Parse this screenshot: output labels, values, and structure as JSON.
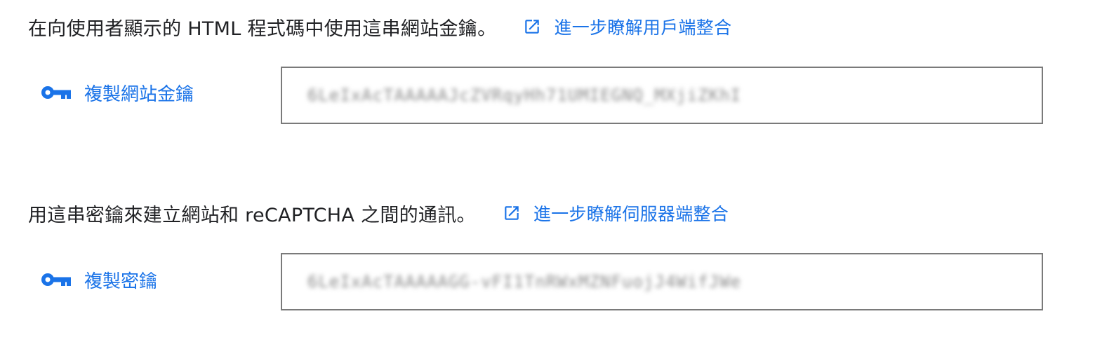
{
  "site_key_section": {
    "description": "在向使用者顯示的 HTML 程式碼中使用這串網站金鑰。",
    "learn_more_label": "進一步瞭解用戶端整合",
    "copy_label": "複製網站金鑰",
    "key_value": "6LeIxAcTAAAAAJcZVRqyHh71UMIEGNQ_MXjiZKhI"
  },
  "secret_key_section": {
    "description": "用這串密鑰來建立網站和 reCAPTCHA 之間的通訊。",
    "learn_more_label": "進一步瞭解伺服器端整合",
    "copy_label": "複製密鑰",
    "key_value": "6LeIxAcTAAAAAGG-vFI1TnRWxMZNFuojJ4WifJWe"
  },
  "colors": {
    "link": "#1a73e8",
    "text": "#202124",
    "box_border": "#7a7a7a"
  },
  "icons": {
    "external_link": "open-in-new-icon",
    "key": "vpn-key-icon"
  }
}
